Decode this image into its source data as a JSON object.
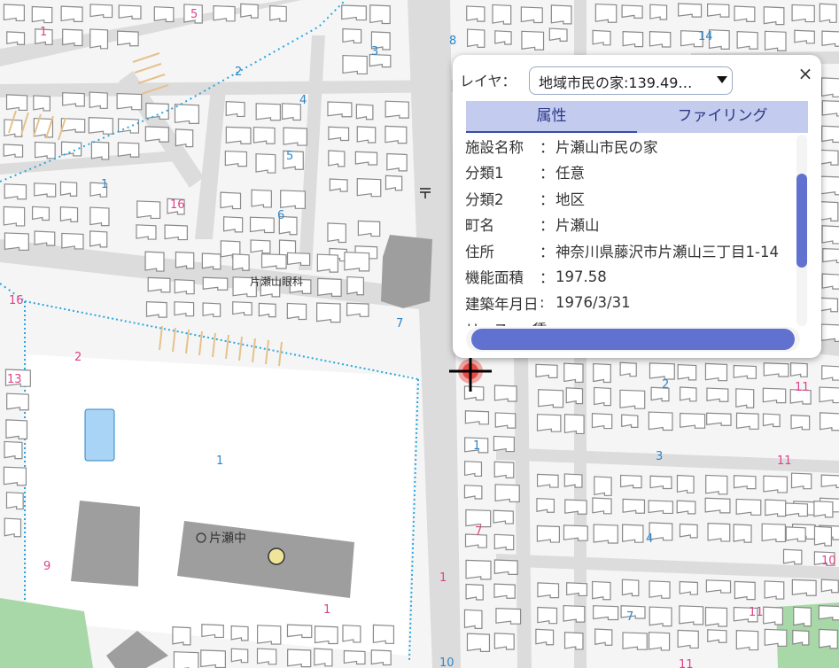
{
  "map": {
    "block_numbers": [
      "1",
      "5",
      "3",
      "2",
      "8",
      "14",
      "4",
      "5",
      "1",
      "16",
      "6",
      "16",
      "7",
      "2",
      "13",
      "1",
      "11",
      "2",
      "3",
      "11",
      "1",
      "7",
      "9",
      "4",
      "10",
      "1",
      "11",
      "7",
      "1",
      "11",
      "10"
    ],
    "poi_labels": {
      "clinic": "片瀬山眼科",
      "school": "片瀬中"
    },
    "colors": {
      "background": "#f5f5f5",
      "road": "#dddddd",
      "building_fill": "#ffffff",
      "building_stroke": "#8a8a8a",
      "large_building": "#9e9e9e",
      "park": "#a8d8a8",
      "pool": "#aad4f5",
      "boundary": "#29a8e0",
      "block_number_blue": "#2e86c8",
      "block_number_pink": "#e0408a",
      "marker": "#f0e49a",
      "selected_marker": "#e8332a"
    }
  },
  "popup": {
    "layer_label": "レイヤ：",
    "layer_value": "地域市民の家:139.49…",
    "close_label": "×",
    "tabs": [
      {
        "label": "属性",
        "active": true
      },
      {
        "label": "ファイリング",
        "active": false
      }
    ],
    "attributes": [
      {
        "key": "施設名称",
        "sep": "：",
        "value": "片瀬山市民の家"
      },
      {
        "key": "分類1",
        "sep": "：",
        "value": "任意"
      },
      {
        "key": "分類2",
        "sep": "：",
        "value": "地区"
      },
      {
        "key": "町名",
        "sep": "：",
        "value": "片瀬山"
      },
      {
        "key": "住所",
        "sep": "：",
        "value": "神奈川県藤沢市片瀬山三丁目1-14"
      },
      {
        "key": "機能面積",
        "sep": "：",
        "value": "197.58"
      },
      {
        "key": "建築年月日",
        "sep": ":",
        "value": "1976/3/31"
      },
      {
        "key": "リース or 賃",
        "sep": "",
        "value": ""
      }
    ]
  }
}
